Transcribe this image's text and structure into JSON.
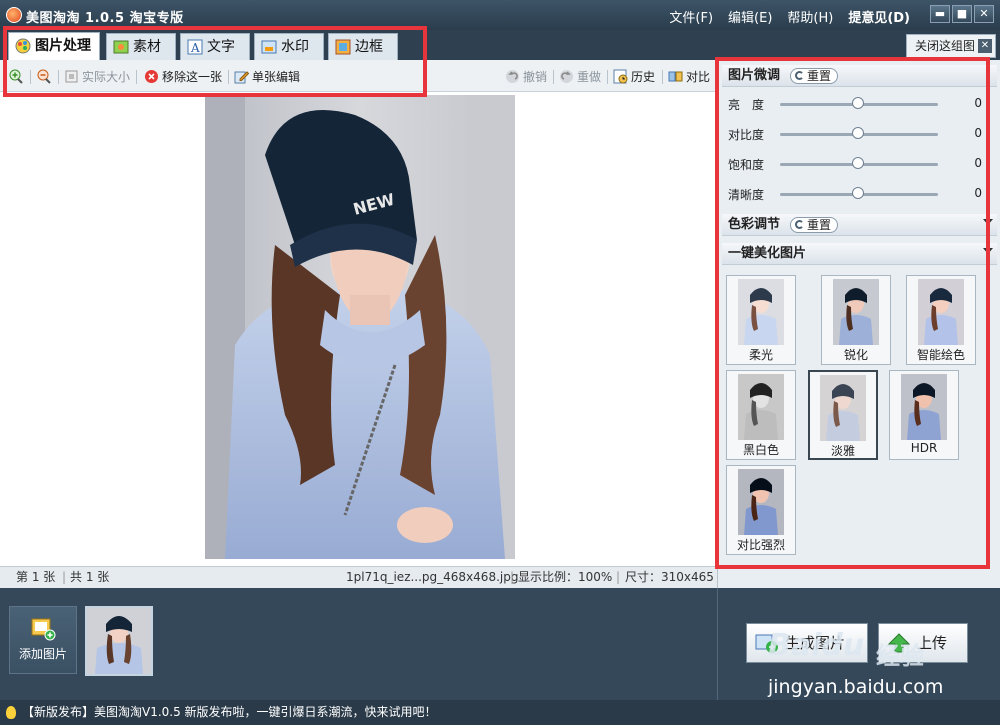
{
  "title": "美图淘淘 1.0.5 淘宝专版",
  "menu": [
    "文件(F)",
    "编辑(E)",
    "帮助(H)",
    "提意见(D)"
  ],
  "window_controls": [
    "▬",
    "■",
    "✕"
  ],
  "tabs": [
    {
      "label": "图片处理",
      "icon": "palette-icon"
    },
    {
      "label": "素材",
      "icon": "sticker-icon"
    },
    {
      "label": "文字",
      "icon": "text-icon"
    },
    {
      "label": "水印",
      "icon": "watermark-icon"
    },
    {
      "label": "边框",
      "icon": "frame-icon"
    }
  ],
  "close_compare": "关闭这组图",
  "toolbar": {
    "actual_size": "实际大小",
    "remove": "移除这一张",
    "single_edit": "单张编辑",
    "undo": "撤销",
    "redo": "重做",
    "history": "历史",
    "compare": "对比"
  },
  "status": {
    "page": "第 1 张",
    "total": "共 1 张",
    "filename": "1pl71q_iez...pg_468x468.jpg",
    "ratio": "显示比例：100%",
    "size": "尺寸：310x465"
  },
  "panel": {
    "fine_tune": "图片微调",
    "reset": "重置",
    "sliders": [
      {
        "label": "亮　度",
        "value": "0"
      },
      {
        "label": "对比度",
        "value": "0"
      },
      {
        "label": "饱和度",
        "value": "0"
      },
      {
        "label": "清晰度",
        "value": "0"
      }
    ],
    "color_adjust": "色彩调节",
    "one_click": "一键美化图片",
    "effects": [
      "柔光",
      "锐化",
      "智能绘色",
      "黑白色",
      "淡雅",
      "HDR",
      "对比强烈"
    ]
  },
  "bottom": {
    "add_image": "添加图片",
    "generate": "生成图片",
    "upload": "上传"
  },
  "news": "【新版发布】美图淘淘V1.0.5 新版发布啦，一键引爆日系潮流，快来试用吧！",
  "watermark": {
    "brand": "Baidu",
    "brand_cn": "经验",
    "url": "jingyan.baidu.com"
  },
  "colors": {
    "highlight": "#e8343b",
    "titlebar": "#2f4150",
    "panel": "#e9eef2"
  }
}
